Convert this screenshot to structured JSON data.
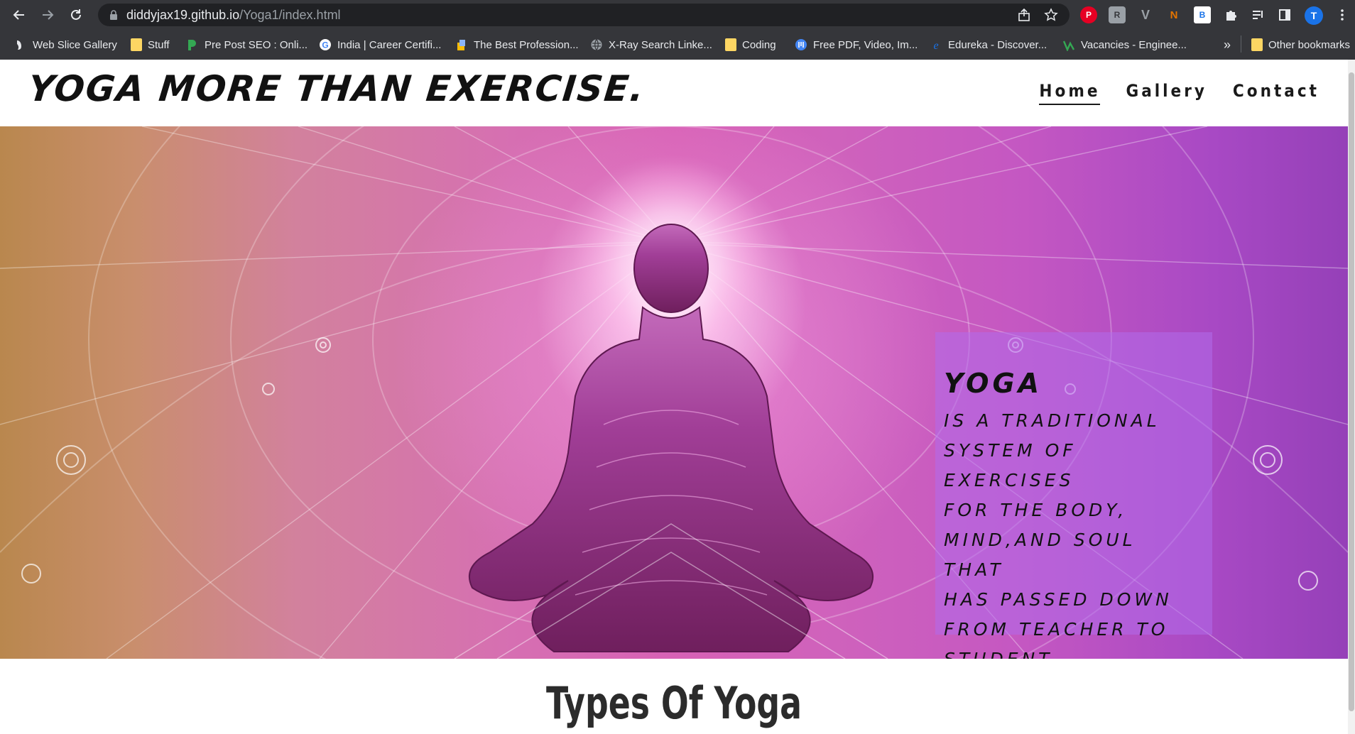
{
  "browser": {
    "url_host": "diddyjax19.github.io",
    "url_path": "/Yoga1/index.html",
    "profile_initial": "T",
    "bookmarks": [
      {
        "label": "Web Slice Gallery",
        "icon": "web-slice-icon"
      },
      {
        "label": "Stuff",
        "icon": "folder-icon"
      },
      {
        "label": "Pre Post SEO : Onli...",
        "icon": "prepostseo-icon"
      },
      {
        "label": "India | Career Certifi...",
        "icon": "google-icon"
      },
      {
        "label": "The Best Profession...",
        "icon": "site-icon"
      },
      {
        "label": "X-Ray Search Linke...",
        "icon": "globe-icon"
      },
      {
        "label": "Coding",
        "icon": "folder-icon"
      },
      {
        "label": "Free PDF, Video, Im...",
        "icon": "site-icon"
      },
      {
        "label": "Edureka - Discover...",
        "icon": "edureka-icon"
      },
      {
        "label": "Vacancies - Enginee...",
        "icon": "site-icon"
      }
    ],
    "overflow_label": "»",
    "other_bookmarks": "Other bookmarks",
    "extensions": [
      {
        "name": "pinterest-icon",
        "glyph": "P",
        "color": "#e60023"
      },
      {
        "name": "extension-r-icon",
        "glyph": "R",
        "color": "#9aa0a6"
      },
      {
        "name": "extension-v-icon",
        "glyph": "V",
        "color": "#9aa0a6"
      },
      {
        "name": "extension-n-icon",
        "glyph": "N",
        "color": "#e37400"
      },
      {
        "name": "extension-b-icon",
        "glyph": "B",
        "color": "#8ab4f8"
      }
    ]
  },
  "site": {
    "title": "YOGA MORE THAN EXERCISE.",
    "nav": [
      {
        "label": "Home",
        "active": true
      },
      {
        "label": "Gallery",
        "active": false
      },
      {
        "label": "Contact",
        "active": false
      }
    ]
  },
  "hero": {
    "heading": "YOGA",
    "lines": [
      "IS A TRADITIONAL",
      "SYSTEM OF EXERCISES",
      "FOR THE BODY,",
      "MIND,AND SOUL THAT",
      "HAS PASSED DOWN",
      "FROM TEACHER TO",
      "STUDENT."
    ]
  },
  "section": {
    "title": "Types Of Yoga"
  },
  "colors": {
    "chrome": "#35363a",
    "omnibox": "#202124",
    "hero_pink": "#d66fb2",
    "hero_purple": "#9540b8",
    "hero_gold": "#b9874e",
    "silhouette": "#8a2b6e"
  }
}
